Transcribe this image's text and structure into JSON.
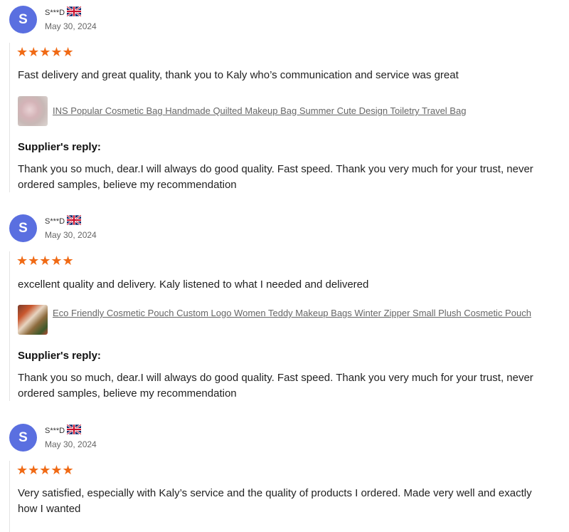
{
  "reviews": [
    {
      "avatar_letter": "S",
      "name": "S***D",
      "country_flag": "uk-flag-icon",
      "date": "May 30, 2024",
      "rating": 5,
      "stars": "★★★★★",
      "text": "Fast delivery and great quality, thank you to Kaly who’s communication and service was great",
      "product": "INS Popular Cosmetic Bag Handmade Quilted Makeup Bag Summer Cute Design Toiletry Travel Bag",
      "reply_heading": "Supplier's reply:",
      "reply": "Thank you so much, dear.I will always do good quality. Fast speed. Thank you very much for your trust, never ordered samples, believe my recommendation"
    },
    {
      "avatar_letter": "S",
      "name": "S***D",
      "country_flag": "uk-flag-icon",
      "date": "May 30, 2024",
      "rating": 5,
      "stars": "★★★★★",
      "text": "excellent quality and delivery. Kaly listened to what I needed and delivered",
      "product": "Eco Friendly Cosmetic Pouch Custom Logo Women Teddy Makeup Bags Winter Zipper Small Plush Cosmetic Pouch",
      "reply_heading": "Supplier's reply:",
      "reply": "Thank you so much, dear.I will always do good quality. Fast speed. Thank you very much for your trust, never ordered samples, believe my recommendation"
    },
    {
      "avatar_letter": "S",
      "name": "S***D",
      "country_flag": "uk-flag-icon",
      "date": "May 30, 2024",
      "rating": 5,
      "stars": "★★★★★",
      "text": "Very satisfied, especially with Kaly’s service and the quality of products I ordered. Made very well and exactly how I wanted"
    }
  ],
  "colors": {
    "avatar": "#5a6fe0",
    "star": "#f06a15",
    "link": "#666666"
  }
}
